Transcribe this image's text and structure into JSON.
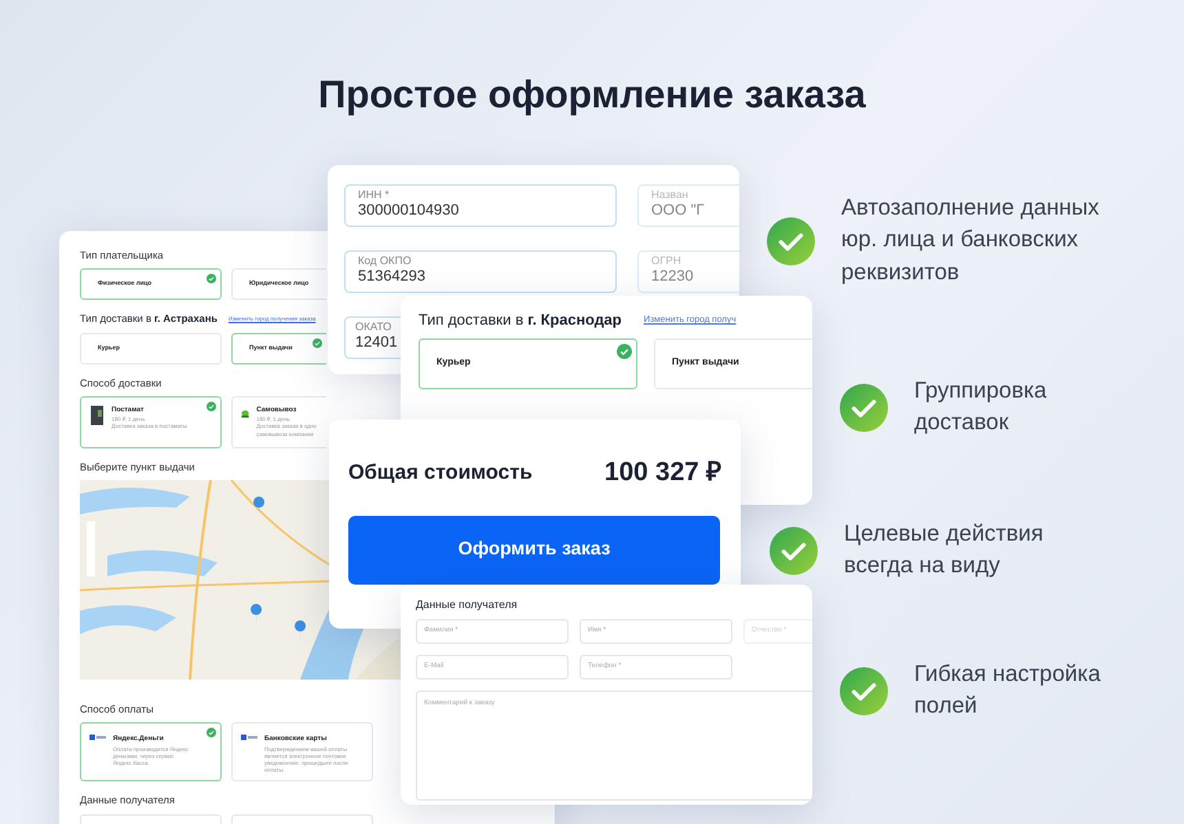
{
  "title": "Простое оформление заказа",
  "order_form": {
    "payer_type": {
      "label": "Тип плательщика",
      "options": [
        {
          "label": "Физическое лицо",
          "selected": true
        },
        {
          "label": "Юридическое лицо",
          "selected": false
        }
      ]
    },
    "delivery_type": {
      "label": "Тип доставки в **г. Астрахань**",
      "link": "Изменить город получения заказа",
      "options": [
        {
          "label": "Курьер",
          "selected": false
        },
        {
          "label": "Пункт выдачи",
          "selected": true
        }
      ]
    },
    "delivery_method": {
      "label": "Способ доставки",
      "options": [
        {
          "kind": "locker",
          "name": "Постамат",
          "price": "180 ₽, 1 день",
          "description": "Доставка заказа в постаматы",
          "selected": true
        },
        {
          "kind": "pickup",
          "name": "Самовывоз",
          "price": "180 ₽, 1 день",
          "description": "Доставка заказа в одно самовывоза компании",
          "selected": false
        }
      ]
    },
    "pickup_point": {
      "label": "Выберите пункт выдачи"
    },
    "payment": {
      "label": "Способ оплаты",
      "options": [
        {
          "name": "Яндекс.Деньги",
          "description": "Оплата производится Яндекс деньгами, через сервис Яндекс.Касса.",
          "selected": true
        },
        {
          "name": "Банковские карты",
          "description": "Подтверждением вашей оплаты является электронное почтовое уведомление, пришедшее после оплаты.",
          "selected": false
        }
      ]
    },
    "recipient_label": "Данные получателя"
  },
  "company_card": {
    "fields": [
      {
        "label": "ИНН *",
        "value": "300000104930",
        "dimmed": false
      },
      {
        "label": "Назван",
        "value": "ООО \"Г",
        "dimmed": true
      },
      {
        "label": "Код ОКПО",
        "value": "51364293",
        "dimmed": false
      },
      {
        "label": "ОГРН",
        "value": "12230",
        "dimmed": true
      },
      {
        "label": "ОКАТО",
        "value": "12401",
        "dimmed": false
      }
    ]
  },
  "delivery_card": {
    "label": "Тип доставки в **г. Краснодар**",
    "link": "Изменить город получ",
    "options": [
      {
        "label": "Курьер",
        "selected": true
      },
      {
        "label": "Пункт выдачи",
        "selected": false
      }
    ]
  },
  "total_card": {
    "label": "Общая стоимость",
    "amount": "100 327 ₽",
    "button": "Оформить заказ"
  },
  "recipient_card": {
    "title": "Данные получателя",
    "fields": [
      {
        "placeholder": "Фамилия *",
        "dimmed": false
      },
      {
        "placeholder": "Имя *",
        "dimmed": false
      },
      {
        "placeholder": "Отчество *",
        "dimmed": true
      },
      {
        "placeholder": "E-Mail",
        "dimmed": false
      },
      {
        "placeholder": "Телефон *",
        "dimmed": false
      }
    ],
    "comment_placeholder": "Комментарий к заказу"
  },
  "features": [
    {
      "text": "Автозаполнение данных юр. лица и банковских реквизитов"
    },
    {
      "text": "Группировка доставок"
    },
    {
      "text": "Целевые действия всегда на виду"
    },
    {
      "text": "Гибкая настройка полей"
    }
  ]
}
